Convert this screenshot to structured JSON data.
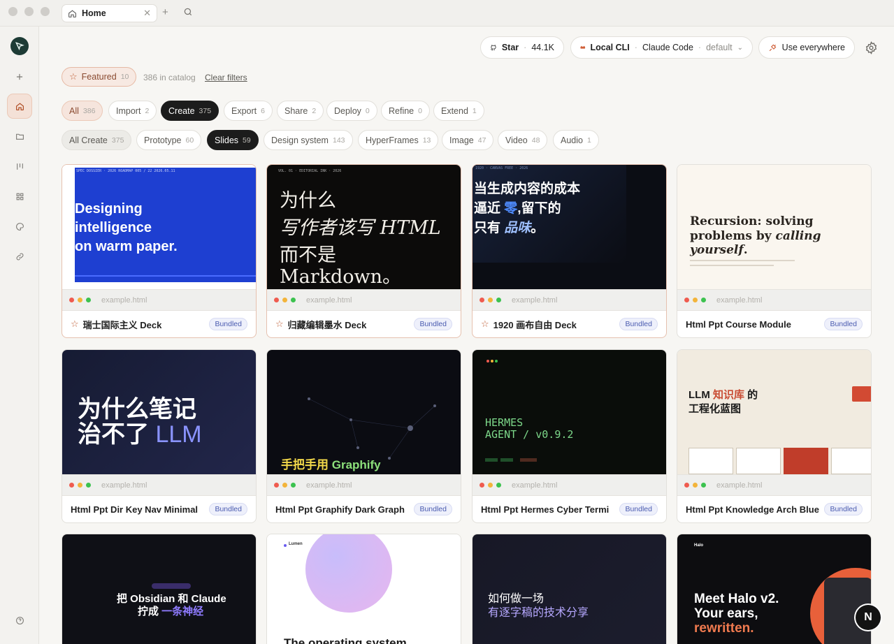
{
  "window": {
    "tab_title": "Home"
  },
  "header": {
    "star_label": "Star",
    "star_count": "44.1K",
    "cli_label": "Local CLI",
    "cli_agent": "Claude Code",
    "cli_mode": "default",
    "use_everywhere": "Use everywhere"
  },
  "featured": {
    "label": "Featured",
    "count": "10",
    "catalog_text": "386 in catalog",
    "clear_filters": "Clear filters"
  },
  "categories": [
    {
      "label": "All",
      "count": "386"
    },
    {
      "label": "Import",
      "count": "2"
    },
    {
      "label": "Create",
      "count": "375"
    },
    {
      "label": "Export",
      "count": "6"
    },
    {
      "label": "Share",
      "count": "2"
    },
    {
      "label": "Deploy",
      "count": "0"
    },
    {
      "label": "Refine",
      "count": "0"
    },
    {
      "label": "Extend",
      "count": "1"
    }
  ],
  "subcategories": [
    {
      "label": "All Create",
      "count": "375"
    },
    {
      "label": "Prototype",
      "count": "60"
    },
    {
      "label": "Slides",
      "count": "59"
    },
    {
      "label": "Design system",
      "count": "143"
    },
    {
      "label": "HyperFrames",
      "count": "13"
    },
    {
      "label": "Image",
      "count": "47"
    },
    {
      "label": "Video",
      "count": "48"
    },
    {
      "label": "Audio",
      "count": "1"
    }
  ],
  "url_text": "example.html",
  "badge_text": "Bundled",
  "cards": [
    {
      "title": "瑞士国际主义 Deck",
      "favorite": true,
      "thumb": {
        "line1": "Designing",
        "line2": "intelligence",
        "line3": "on warm paper."
      }
    },
    {
      "title": "归藏编辑墨水 Deck",
      "favorite": true,
      "thumb": {
        "line1": "为什么",
        "line2": "写作者该写 HTML",
        "line3": "而不是 Markdown。"
      }
    },
    {
      "title": "1920 画布自由 Deck",
      "favorite": true,
      "thumb": {
        "line1": "当生成内容的成本",
        "line2a": "逼近 ",
        "line2b": "零",
        "line2c": ",留下的",
        "line3a": "只有 ",
        "line3b": "品味",
        "line3c": "。"
      }
    },
    {
      "title": "Html Ppt Course Module",
      "favorite": false,
      "thumb": {
        "line1": "Recursion: solving",
        "line2a": "problems by ",
        "line2b": "calling yourself",
        "line2c": "."
      }
    },
    {
      "title": "Html Ppt Dir Key Nav Minimal",
      "favorite": false,
      "thumb": {
        "line1": "为什么笔记",
        "line2a": "治不了 ",
        "line2b": "LLM"
      }
    },
    {
      "title": "Html Ppt Graphify Dark Graph",
      "favorite": false,
      "thumb": {
        "line1a": "手把手用 ",
        "line1b": "Graphify"
      }
    },
    {
      "title": "Html Ppt Hermes Cyber Termi",
      "favorite": false,
      "thumb": {
        "line1": "HERMES",
        "line2": "AGENT / v0.9.2"
      }
    },
    {
      "title": "Html Ppt Knowledge Arch Blue",
      "favorite": false,
      "thumb": {
        "line1a": "LLM ",
        "line1b": "知识库",
        "line1c": " 的",
        "line2": "工程化蓝图"
      }
    },
    {
      "title": "",
      "favorite": false,
      "thumb": {
        "line1": "把 Obsidian 和 Claude",
        "line2a": "拧成 ",
        "line2b": "一条神经"
      }
    },
    {
      "title": "",
      "favorite": false,
      "thumb": {
        "brand": "Lumen",
        "line1": "The operating system"
      }
    },
    {
      "title": "",
      "favorite": false,
      "thumb": {
        "line1": "如何做一场",
        "line2": "有逐字稿的技术分享"
      }
    },
    {
      "title": "",
      "favorite": false,
      "thumb": {
        "brand": "Halo",
        "line1": "Meet Halo v2.",
        "line2": "Your ears,",
        "line3": "rewritten."
      }
    }
  ],
  "colors": {
    "accent": "#c0623a",
    "dark_chip": "#1c1c1c",
    "badge": "#4a5bb0"
  }
}
